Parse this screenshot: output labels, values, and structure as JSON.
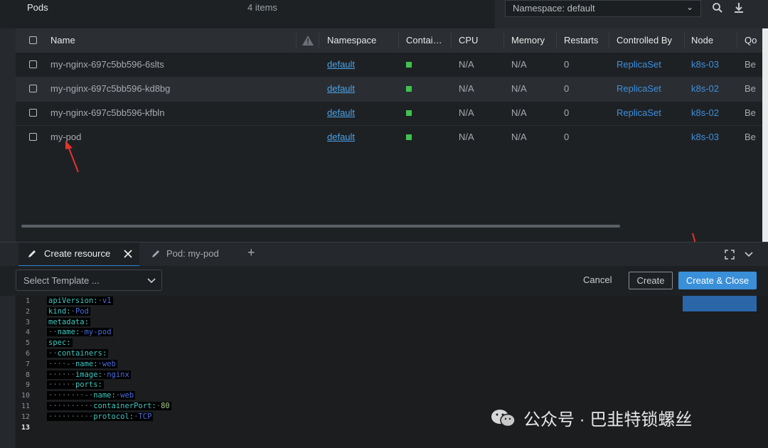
{
  "header": {
    "title": "Pods",
    "item_count": "4 items",
    "namespace_select": "Namespace: default",
    "icons": [
      "search-icon",
      "download-icon",
      "chevron-down-icon"
    ]
  },
  "table": {
    "columns": [
      "Name",
      "Namespace",
      "Contai…",
      "CPU",
      "Memory",
      "Restarts",
      "Controlled By",
      "Node",
      "Qo"
    ],
    "warning_icon": "warning-icon",
    "rows": [
      {
        "name": "my-nginx-697c5bb596-6slts",
        "namespace": "default",
        "cpu": "N/A",
        "memory": "N/A",
        "restarts": "0",
        "controlled_by": "ReplicaSet",
        "node": "k8s-03",
        "qos": "Be"
      },
      {
        "name": "my-nginx-697c5bb596-kd8bg",
        "namespace": "default",
        "cpu": "N/A",
        "memory": "N/A",
        "restarts": "0",
        "controlled_by": "ReplicaSet",
        "node": "k8s-02",
        "qos": "Be"
      },
      {
        "name": "my-nginx-697c5bb596-kfbln",
        "namespace": "default",
        "cpu": "N/A",
        "memory": "N/A",
        "restarts": "0",
        "controlled_by": "ReplicaSet",
        "node": "k8s-02",
        "qos": "Be"
      },
      {
        "name": "my-pod",
        "namespace": "default",
        "cpu": "N/A",
        "memory": "N/A",
        "restarts": "0",
        "controlled_by": "",
        "node": "k8s-03",
        "qos": "Be"
      }
    ],
    "status_color": "#3fc24f"
  },
  "dock": {
    "tabs": [
      {
        "label": "Create resource",
        "icon": "pencil-icon",
        "active": true
      },
      {
        "label": "Pod: my-pod",
        "icon": "pencil-icon",
        "active": false
      }
    ],
    "add_tab": "+",
    "template_placeholder": "Select Template ...",
    "cancel_label": "Cancel",
    "create_label": "Create",
    "create_close_label": "Create & Close",
    "accent_color": "#3a8fd9"
  },
  "editor": {
    "lines": [
      {
        "no": "1",
        "text": "apiVersion:·v1"
      },
      {
        "no": "2",
        "text": "kind:·Pod"
      },
      {
        "no": "3",
        "text": "metadata:"
      },
      {
        "no": "4",
        "text": "··name:·my-pod"
      },
      {
        "no": "5",
        "text": "spec:"
      },
      {
        "no": "6",
        "text": "··containers:"
      },
      {
        "no": "7",
        "text": "····-·name:·web"
      },
      {
        "no": "8",
        "text": "······image:·nginx"
      },
      {
        "no": "9",
        "text": "······ports:"
      },
      {
        "no": "10",
        "text": "········-·name:·web"
      },
      {
        "no": "11",
        "text": "··········containerPort:·80"
      },
      {
        "no": "12",
        "text": "··········protocol:·TCP"
      },
      {
        "no": "13",
        "text": ""
      }
    ]
  },
  "watermark": "公众号 · 巴韭特锁螺丝"
}
